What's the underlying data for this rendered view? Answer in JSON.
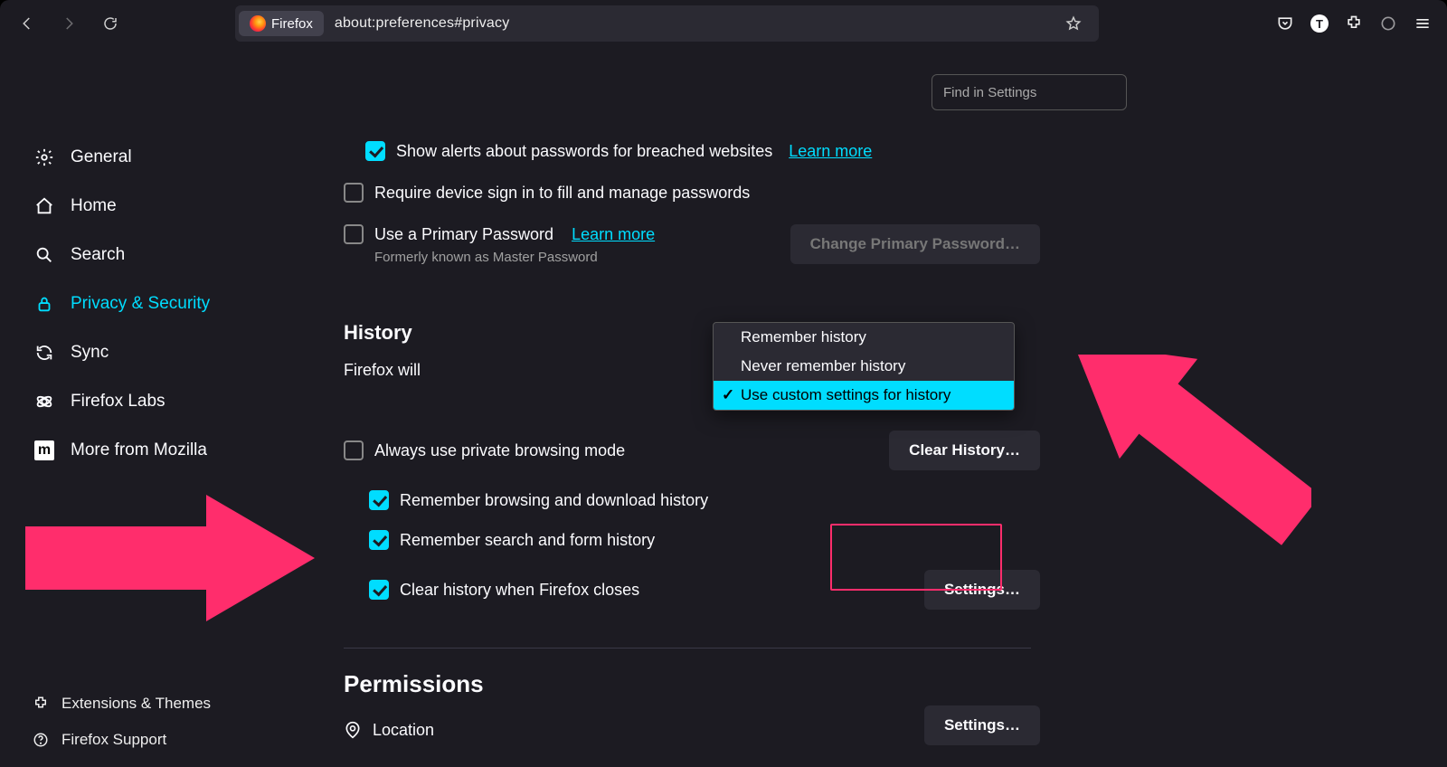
{
  "chrome": {
    "app_name": "Firefox",
    "url": "about:preferences#privacy"
  },
  "search": {
    "placeholder": "Find in Settings"
  },
  "sidebar": {
    "items": [
      {
        "label": "General"
      },
      {
        "label": "Home"
      },
      {
        "label": "Search"
      },
      {
        "label": "Privacy & Security"
      },
      {
        "label": "Sync"
      },
      {
        "label": "Firefox Labs"
      },
      {
        "label": "More from Mozilla"
      }
    ],
    "bottom": [
      {
        "label": "Extensions & Themes"
      },
      {
        "label": "Firefox Support"
      }
    ]
  },
  "passwords": {
    "breach_alerts": "Show alerts about passwords for breached websites",
    "learn_more": "Learn more",
    "require_signin": "Require device sign in to fill and manage passwords",
    "primary_pw": "Use a Primary Password",
    "primary_pw_note": "Formerly known as Master Password",
    "change_pw_btn": "Change Primary Password…"
  },
  "history": {
    "title": "History",
    "firefox_will": "Firefox will",
    "options": [
      "Remember history",
      "Never remember history",
      "Use custom settings for history"
    ],
    "always_private": "Always use private browsing mode",
    "remember_browsing": "Remember browsing and download history",
    "remember_search": "Remember search and form history",
    "clear_on_close": "Clear history when Firefox closes",
    "clear_btn": "Clear History…",
    "settings_btn": "Settings…"
  },
  "permissions": {
    "title": "Permissions",
    "location": "Location",
    "settings_btn": "Settings…"
  },
  "annotation_arrows": {
    "color": "#ff2d6c",
    "left_target": "clear-history-checkbox",
    "right_target": "history-settings-button"
  }
}
